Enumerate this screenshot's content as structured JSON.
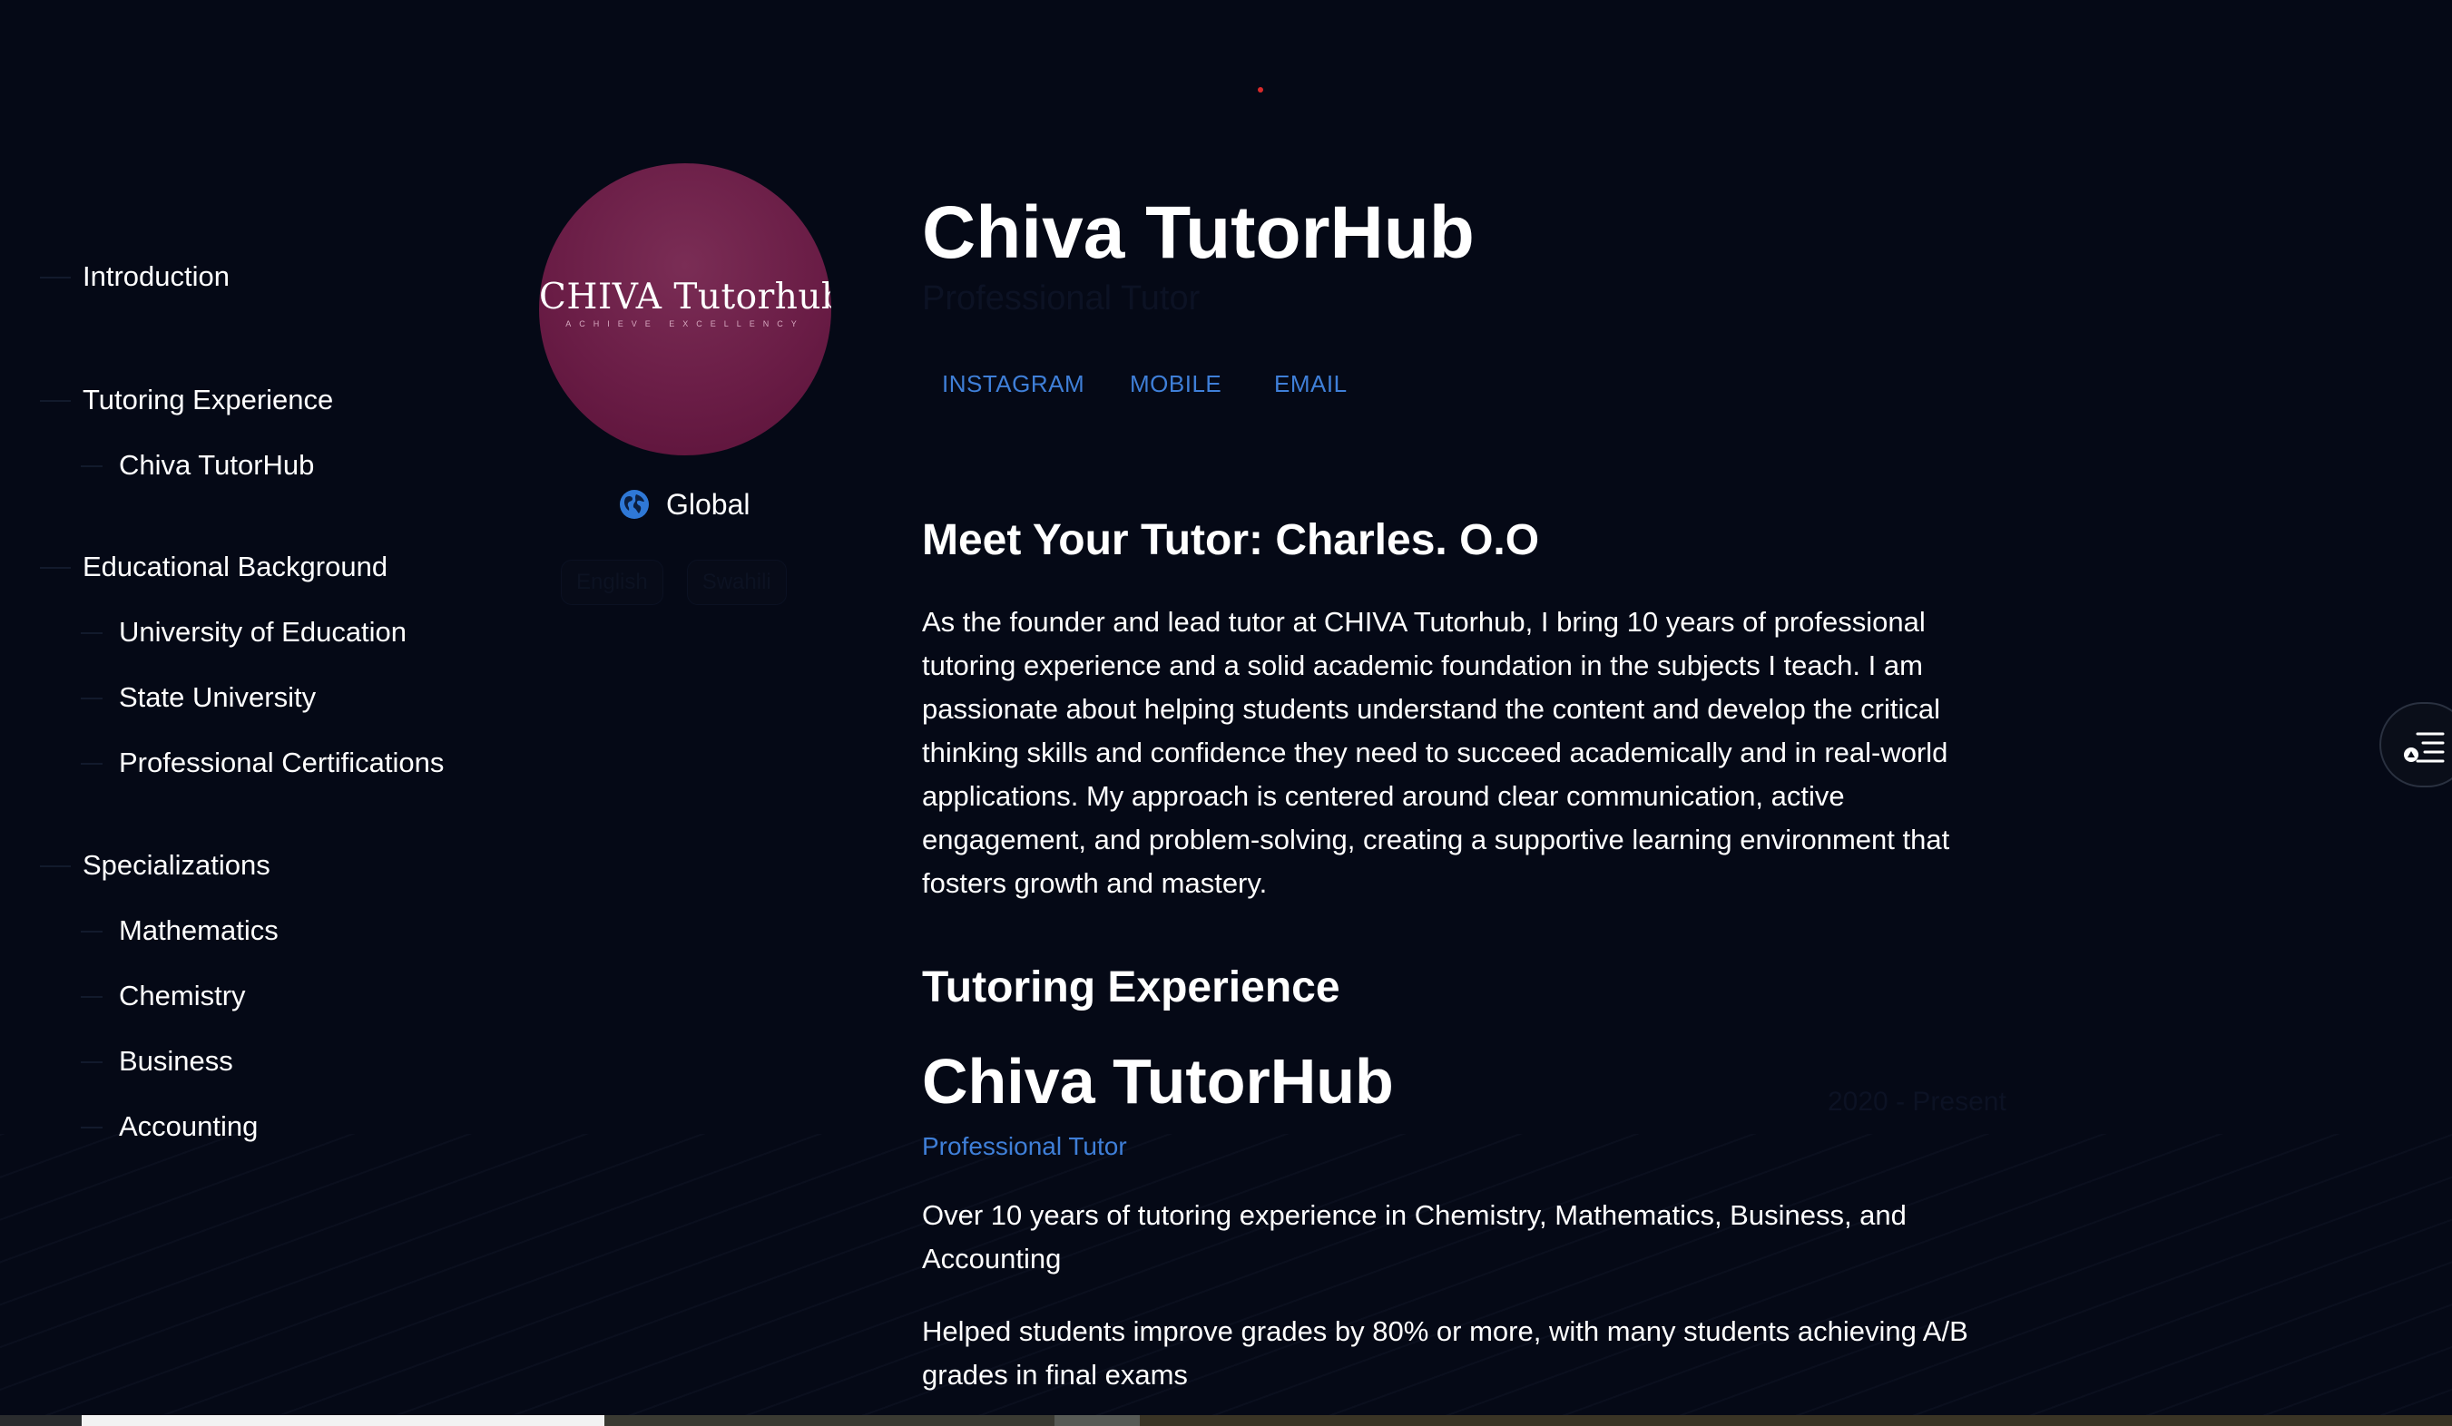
{
  "nav": {
    "introduction": "Introduction",
    "tutoring_experience": "Tutoring Experience",
    "chiva_tutorhub": "Chiva TutorHub",
    "educational_background": "Educational Background",
    "university_of_education": "University of Education",
    "state_university": "State University",
    "professional_certifications": "Professional Certifications",
    "specializations": "Specializations",
    "mathematics": "Mathematics",
    "chemistry": "Chemistry",
    "business": "Business",
    "accounting": "Accounting"
  },
  "profile": {
    "logo_text": "CHIVA Tutorhub",
    "logo_tagline": "ACHIEVE EXCELLENCY",
    "location_icon": "globe-icon",
    "location": "Global",
    "languages": [
      "English",
      "Swahili"
    ]
  },
  "header": {
    "title": "Chiva TutorHub",
    "role": "Professional Tutor",
    "links": {
      "instagram": "INSTAGRAM",
      "mobile": "MOBILE",
      "email": "EMAIL"
    }
  },
  "intro": {
    "heading": "Meet Your Tutor: Charles. O.O",
    "body": "As the founder and lead tutor at CHIVA Tutorhub, I bring 10 years of professional tutoring experience and a solid academic foundation in the subjects I teach. I am passionate about helping students understand the content and develop the critical thinking skills and confidence they need to succeed academically and in real-world applications. My approach is centered around clear communication, active engagement, and problem-solving, creating a supportive learning environment that fosters growth and mastery."
  },
  "experience": {
    "heading": "Tutoring Experience",
    "company": "Chiva TutorHub",
    "dates": "2020 - Present",
    "role": "Professional Tutor",
    "points": [
      "Over 10 years of tutoring experience in Chemistry, Mathematics, Business, and Accounting",
      "Helped students improve grades by 80% or more, with many students achieving A/B grades in final exams"
    ]
  },
  "floating_button_icon": "table-of-contents-icon",
  "colors": {
    "background": "#050916",
    "accent": "#3f7fd8",
    "avatar": "#6a1d46"
  }
}
